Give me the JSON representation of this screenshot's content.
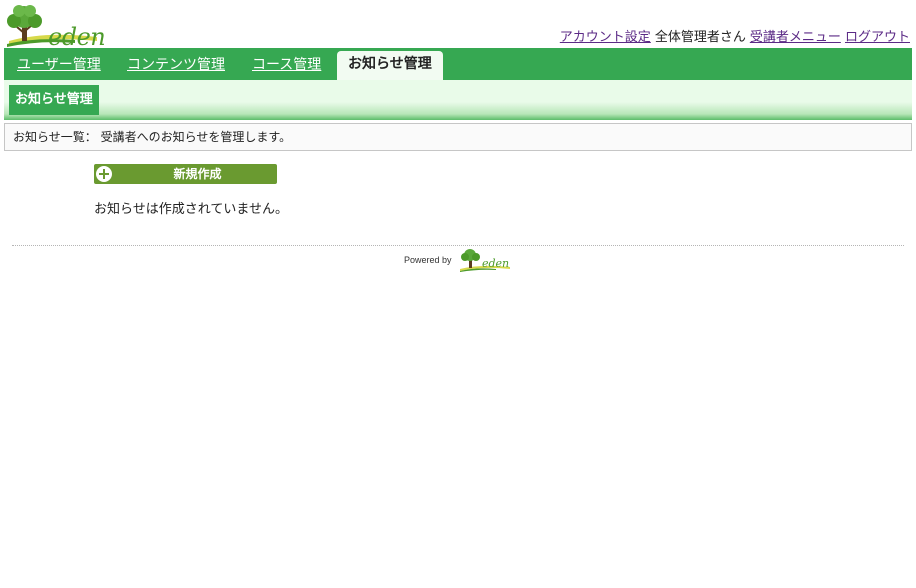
{
  "brand": {
    "name": "eden"
  },
  "header": {
    "links": {
      "account_settings": "アカウント設定",
      "user_name": "全体管理者さん",
      "learner_menu": "受講者メニュー",
      "logout": "ログアウト"
    }
  },
  "nav": {
    "tabs": [
      {
        "label": "ユーザー管理",
        "active": false
      },
      {
        "label": "コンテンツ管理",
        "active": false
      },
      {
        "label": "コース管理",
        "active": false
      },
      {
        "label": "お知らせ管理",
        "active": true
      }
    ]
  },
  "subnav": {
    "current": "お知らせ管理"
  },
  "description": "お知らせ一覧： 受講者へのお知らせを管理します。",
  "main": {
    "new_button_label": "新規作成",
    "empty_message": "お知らせは作成されていません。"
  },
  "footer": {
    "powered_by": "Powered by",
    "brand": "eden"
  },
  "colors": {
    "primary_green": "#36a852",
    "button_green": "#6a9a30",
    "logo_green": "#4c9a2a",
    "link_purple": "#5b2a86"
  }
}
